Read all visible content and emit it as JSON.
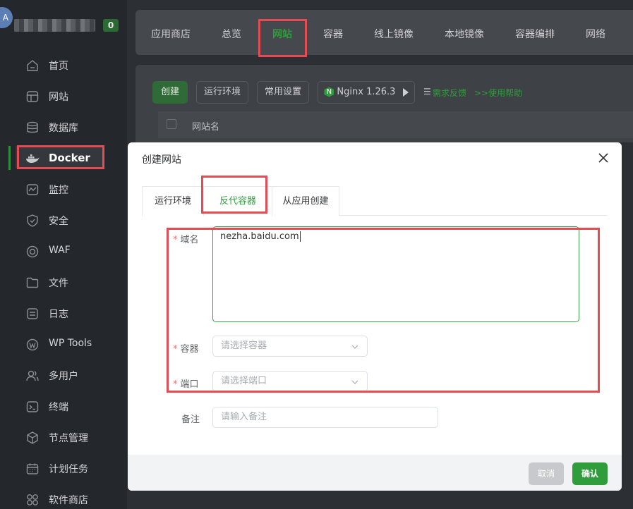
{
  "sidebar": {
    "avatar_text": "A",
    "badge": "0",
    "items": [
      {
        "label": "首页",
        "icon": "home-icon"
      },
      {
        "label": "网站",
        "icon": "website-icon"
      },
      {
        "label": "数据库",
        "icon": "database-icon"
      },
      {
        "label": "Docker",
        "icon": "docker-icon"
      },
      {
        "label": "监控",
        "icon": "monitor-icon"
      },
      {
        "label": "安全",
        "icon": "shield-icon"
      },
      {
        "label": "WAF",
        "icon": "waf-icon"
      },
      {
        "label": "文件",
        "icon": "folder-icon"
      },
      {
        "label": "日志",
        "icon": "log-icon"
      },
      {
        "label": "WP Tools",
        "icon": "wordpress-icon"
      },
      {
        "label": "多用户",
        "icon": "users-icon"
      },
      {
        "label": "终端",
        "icon": "terminal-icon"
      },
      {
        "label": "节点管理",
        "icon": "node-icon"
      },
      {
        "label": "计划任务",
        "icon": "calendar-icon"
      },
      {
        "label": "软件商店",
        "icon": "store-icon"
      }
    ]
  },
  "top_tabs": [
    "应用商店",
    "总览",
    "网站",
    "容器",
    "线上镜像",
    "本地镜像",
    "容器编排",
    "网络"
  ],
  "toolbar": {
    "create": "创建",
    "runtime": "运行环境",
    "settings": "常用设置",
    "nginx": "Nginx 1.26.3",
    "feedback": "需求反馈",
    "help": ">>使用帮助",
    "table_header": "网站名"
  },
  "dialog": {
    "title": "创建网站",
    "tabs": [
      "运行环境",
      "反代容器",
      "从应用创建"
    ],
    "domain_label": "域名",
    "domain_value": "nezha.baidu.com",
    "container_label": "容器",
    "container_placeholder": "请选择容器",
    "port_label": "端口",
    "port_placeholder": "请选择端口",
    "remark_label": "备注",
    "remark_placeholder": "请输入备注",
    "cancel": "取消",
    "confirm": "确认"
  },
  "colors": {
    "accent": "#2f9d3c",
    "highlight": "#e34c52",
    "sidebar_bg": "#24272b"
  }
}
